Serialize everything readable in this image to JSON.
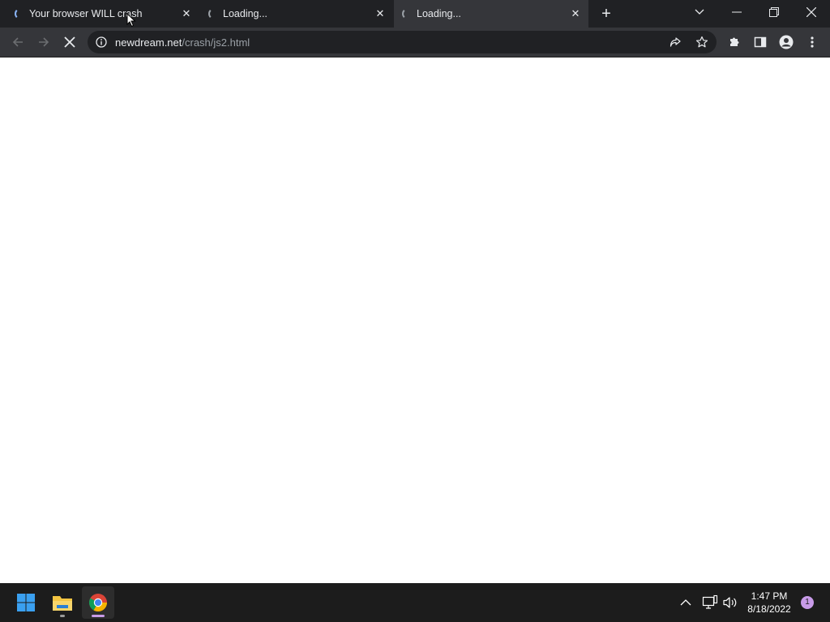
{
  "browser": {
    "tabs": [
      {
        "title": "Your browser WILL crash",
        "state": "loading"
      },
      {
        "title": "Loading...",
        "state": "loading"
      },
      {
        "title": "Loading...",
        "state": "loading"
      }
    ],
    "tab_close_glyph": "✕",
    "new_tab_glyph": "+",
    "url_host": "newdream.net",
    "url_path": "/crash/js2.html"
  },
  "taskbar": {
    "time": "1:47 PM",
    "date": "8/18/2022",
    "notification_count": "1"
  },
  "colors": {
    "tabstrip_bg": "#202124",
    "toolbar_bg": "#35363a",
    "omnibox_bg": "#202124",
    "text_primary": "#e8eaed",
    "text_secondary": "#9aa0a6",
    "taskbar_bg": "#1c1c1c",
    "notification_badge": "#c89be8"
  },
  "icons": {
    "back": "back-arrow-icon",
    "forward": "forward-arrow-icon",
    "stop": "stop-loading-icon",
    "site_info": "info-icon",
    "share": "share-icon",
    "bookmark": "star-icon",
    "extensions": "puzzle-icon",
    "side_panel": "side-panel-icon",
    "profile": "profile-icon",
    "menu": "kebab-menu-icon",
    "start": "windows-start-icon",
    "explorer": "file-explorer-icon",
    "chrome": "chrome-icon"
  }
}
